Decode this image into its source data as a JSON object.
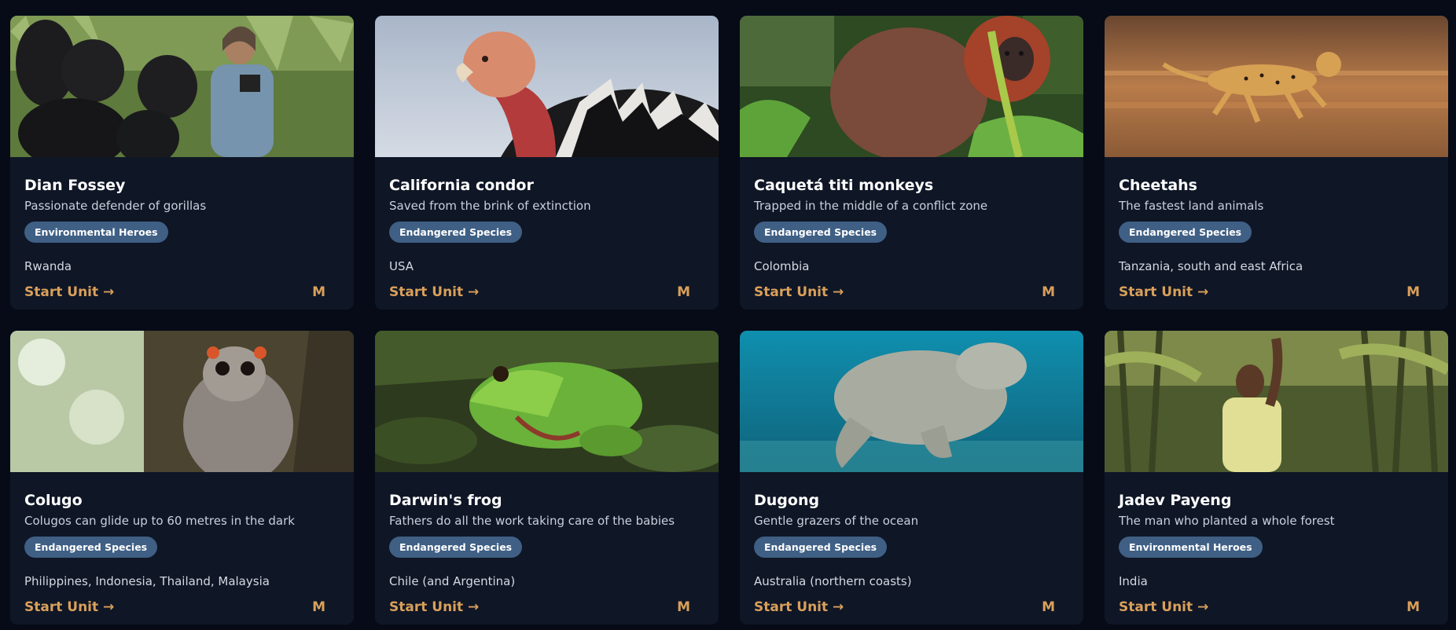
{
  "cards": [
    {
      "title": "Dian Fossey",
      "subtitle": "Passionate defender of gorillas",
      "tag": "Environmental Heroes",
      "location": "Rwanda",
      "action": "Start Unit →",
      "level": "M",
      "image": "gorillas-photo"
    },
    {
      "title": "California condor",
      "subtitle": "Saved from the brink of extinction",
      "tag": "Endangered Species",
      "location": "USA",
      "action": "Start Unit →",
      "level": "M",
      "image": "condor-photo"
    },
    {
      "title": "Caquetá titi monkeys",
      "subtitle": "Trapped in the middle of a conflict zone",
      "tag": "Endangered Species",
      "location": "Colombia",
      "action": "Start Unit →",
      "level": "M",
      "image": "titi-monkey-photo"
    },
    {
      "title": "Cheetahs",
      "subtitle": "The fastest land animals",
      "tag": "Endangered Species",
      "location": "Tanzania, south and east Africa",
      "action": "Start Unit →",
      "level": "M",
      "image": "cheetah-photo"
    },
    {
      "title": "Colugo",
      "subtitle": "Colugos can glide up to 60 metres in the dark",
      "tag": "Endangered Species",
      "location": "Philippines, Indonesia, Thailand, Malaysia",
      "action": "Start Unit →",
      "level": "M",
      "image": "colugo-photo"
    },
    {
      "title": "Darwin's frog",
      "subtitle": "Fathers do all the work taking care of the babies",
      "tag": "Endangered Species",
      "location": "Chile (and Argentina)",
      "action": "Start Unit →",
      "level": "M",
      "image": "frog-photo"
    },
    {
      "title": "Dugong",
      "subtitle": "Gentle grazers of the ocean",
      "tag": "Endangered Species",
      "location": "Australia (northern coasts)",
      "action": "Start Unit →",
      "level": "M",
      "image": "dugong-photo"
    },
    {
      "title": "Jadev Payeng",
      "subtitle": "The man who planted a whole forest",
      "tag": "Environmental Heroes",
      "location": "India",
      "action": "Start Unit →",
      "level": "M",
      "image": "forest-man-photo"
    }
  ]
}
